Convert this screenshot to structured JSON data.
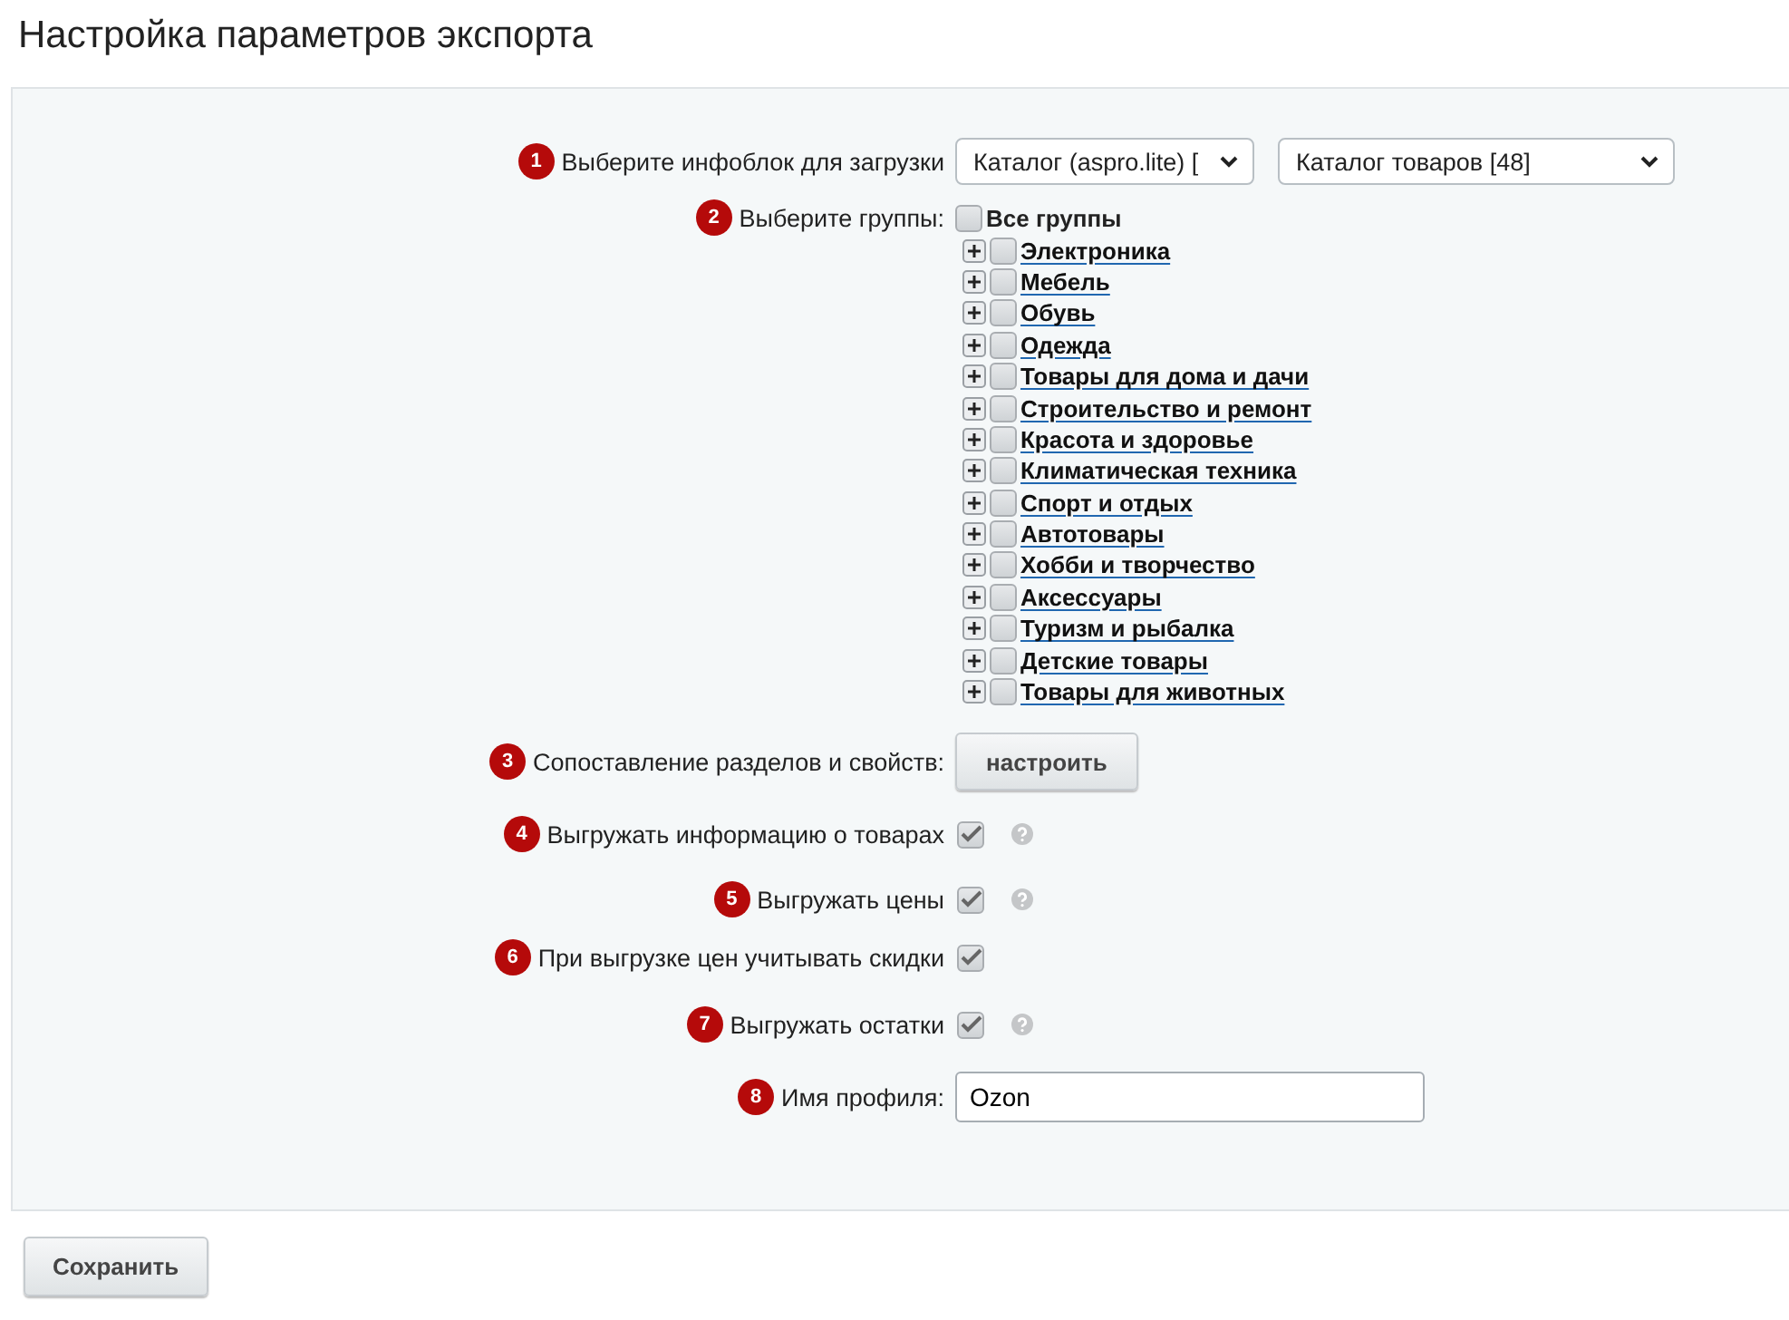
{
  "title": "Настройка параметров экспорта",
  "rows": [
    {
      "kind": "select",
      "badge": "1",
      "label": "Выберите инфоблок для загрузки",
      "selects": [
        "Каталог (aspro.lite) [",
        "Каталог товаров [48]"
      ]
    },
    {
      "kind": "tree",
      "badge": "2",
      "label": "Выберите группы:",
      "all": {
        "label": "Все группы",
        "checked": false
      },
      "groups": [
        {
          "label": "Электроника",
          "checked": false
        },
        {
          "label": "Мебель",
          "checked": false
        },
        {
          "label": "Обувь",
          "checked": false
        },
        {
          "label": "Одежда",
          "checked": false
        },
        {
          "label": "Товары для дома и дачи",
          "checked": false
        },
        {
          "label": "Строительство и ремонт",
          "checked": false
        },
        {
          "label": "Красота и здоровье",
          "checked": false
        },
        {
          "label": "Климатическая техника",
          "checked": false
        },
        {
          "label": "Спорт и отдых",
          "checked": false
        },
        {
          "label": "Автотовары",
          "checked": false
        },
        {
          "label": "Хобби и творчество",
          "checked": false
        },
        {
          "label": "Аксессуары",
          "checked": false
        },
        {
          "label": "Туризм и рыбалка",
          "checked": false
        },
        {
          "label": "Детские товары",
          "checked": false
        },
        {
          "label": "Товары для животных",
          "checked": false
        }
      ]
    },
    {
      "kind": "button",
      "badge": "3",
      "label": "Сопоставление разделов и свойств:",
      "button": "настроить"
    },
    {
      "kind": "checkbox",
      "badge": "4",
      "label": "Выгружать информацию о товарах",
      "checked": true,
      "help": true
    },
    {
      "kind": "checkbox",
      "badge": "5",
      "label": "Выгружать цены",
      "checked": true,
      "help": true
    },
    {
      "kind": "checkbox",
      "badge": "6",
      "label": "При выгрузке цен учитывать скидки",
      "checked": true,
      "help": false
    },
    {
      "kind": "checkbox",
      "badge": "7",
      "label": "Выгружать остатки",
      "checked": true,
      "help": true
    },
    {
      "kind": "input",
      "badge": "8",
      "label": "Имя профиля:",
      "value": "Ozon"
    }
  ],
  "save_button": "Сохранить"
}
